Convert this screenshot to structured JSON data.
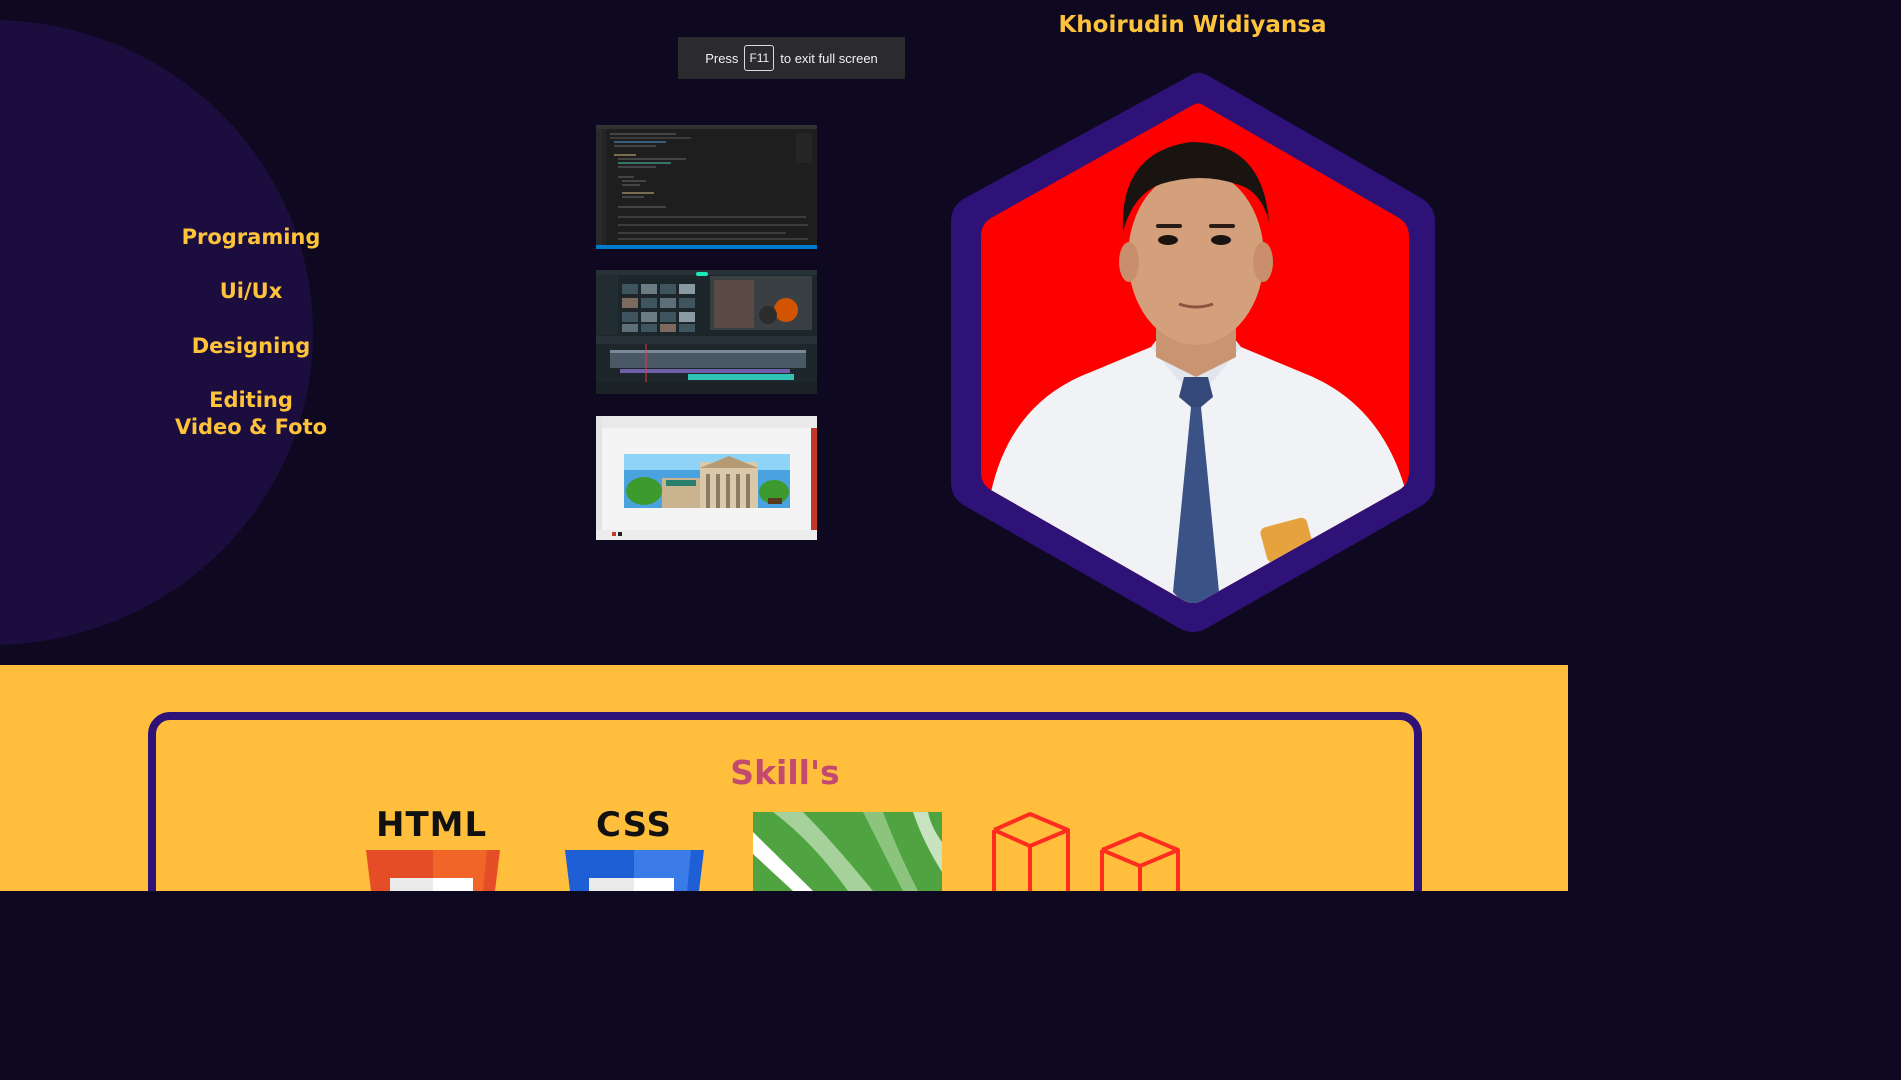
{
  "browser": {
    "fullscreen_notice": {
      "prefix": "Press",
      "key": "F11",
      "suffix": "to exit full screen"
    }
  },
  "header": {
    "name": "Khoirudin Widiyansa"
  },
  "menu": {
    "items": [
      {
        "label": "Programing"
      },
      {
        "label": "Ui/Ux"
      },
      {
        "label": "Designing"
      },
      {
        "label_line1": "Editing",
        "label_line2": "Video & Foto"
      }
    ]
  },
  "portfolio": {
    "thumbnails": [
      {
        "icon": "code-editor-thumbnail"
      },
      {
        "icon": "video-editor-thumbnail"
      },
      {
        "icon": "graphic-design-thumbnail"
      }
    ]
  },
  "skills": {
    "title": "Skill's",
    "items": [
      {
        "label": "HTML",
        "icon": "html5-icon"
      },
      {
        "label": "CSS",
        "icon": "css3-icon"
      },
      {
        "label": "",
        "icon": "corel-draw-icon"
      },
      {
        "label": "",
        "icon": "laravel-icon"
      }
    ]
  },
  "colors": {
    "background_dark": "#0e0920",
    "circle": "#1b0e3f",
    "accent_yellow": "#ffc33b",
    "section_yellow": "#ffbf3c",
    "purple_frame": "#2f1278",
    "skills_title": "#c4496f",
    "photo_background": "#ff0000"
  }
}
